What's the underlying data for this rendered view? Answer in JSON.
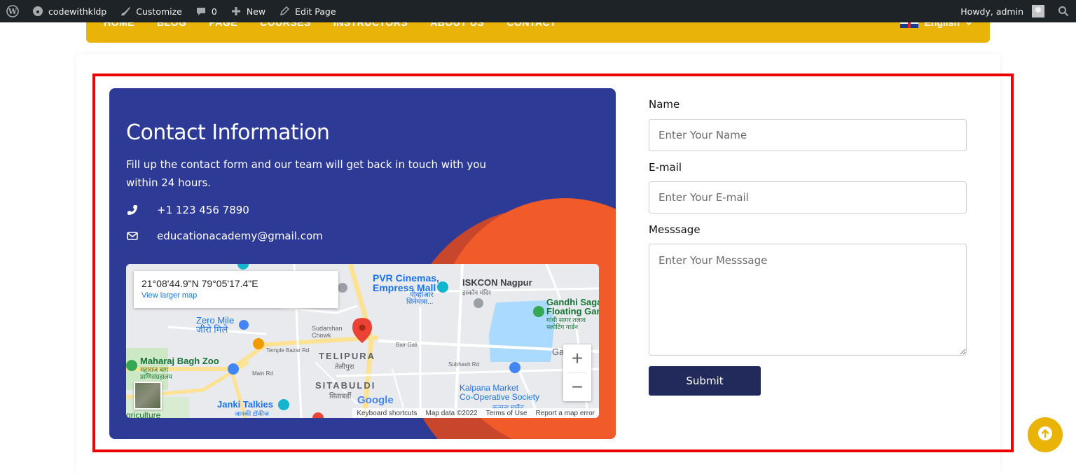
{
  "adminbar": {
    "site_name": "codewithkldp",
    "customize": "Customize",
    "comments_count": "0",
    "new": "New",
    "edit_page": "Edit Page",
    "howdy": "Howdy, admin"
  },
  "nav": {
    "items": [
      "HOME",
      "BLOG",
      "PAGE",
      "COURSES",
      "INSTRUCTORS",
      "ABOUT US",
      "CONTACT"
    ],
    "language": "English"
  },
  "contact_info": {
    "title": "Contact Information",
    "description": "Fill up the contact form and our team will get back in touch with you within 24 hours.",
    "phone": "+1 123 456 7890",
    "email": "educationacademy@gmail.com"
  },
  "map": {
    "coordinates": "21°08'44.9\"N 79°05'17.4\"E",
    "view_larger": "View larger map",
    "labels": {
      "pvr": "PVR Cinemas,",
      "pvr2": "Empress Mall",
      "pvr_hi": "पीव्हीआर",
      "pvr_hi2": "सिनेमास...",
      "iskcon": "ISKCON Nagpur",
      "iskcon_hi": "इस्कॉन मंदिर",
      "gandhi": "Gandhi Saga",
      "gandhi2": "Floating Gar",
      "gandhi_hi": "गांधी सागर तलाव",
      "gandhi_hi2": "फ्लोटिंग गार्डन",
      "zero_mile": "Zero Mile",
      "zero_mile_hi": "जीरो मिले",
      "sudarshan": "Sudarshan",
      "chowk": "Chowk",
      "temple_bazar": "Temple Bazar Rd",
      "bair_gali": "Bair Gali",
      "telipura": "TELIPURA",
      "telipura_hi": "तेलीपुरा",
      "maharaj": "Maharaj Bagh Zoo",
      "maharaj_hi": "महाराज बाग",
      "maharaj_hi2": "प्राणिसंग्रहालय",
      "main_rd": "Main Rd",
      "subhash": "Subhash Rd",
      "sitabuldi": "SITABULDI",
      "sitabuldi_hi": "सिताबर्डी",
      "kalpana": "Kalpana Market",
      "kalpana2": "Co-Operative Society",
      "kalpana_hi": "कल्पना मार्केट",
      "janki": "Janki Talkies",
      "janki_hi": "जानकी टॉकीज",
      "agriculture": "griculture",
      "ga": "Ga",
      "google": "Google"
    },
    "zoom_in": "+",
    "zoom_out": "−",
    "attribution": {
      "shortcuts": "Keyboard shortcuts",
      "data": "Map data ©2022",
      "terms": "Terms of Use",
      "report": "Report a map error"
    }
  },
  "form": {
    "name_label": "Name",
    "name_placeholder": "Enter Your Name",
    "email_label": "E-mail",
    "email_placeholder": "Enter Your E-mail",
    "message_label": "Messsage",
    "message_placeholder": "Enter Your Messsage",
    "submit": "Submit"
  },
  "colors": {
    "adminbar": "#1d2327",
    "nav": "#eab308",
    "panel": "#2d3a96",
    "accent_orange": "#f15a29",
    "submit": "#212a5a",
    "outline": "#ef0000"
  },
  "icons": [
    "wordpress-icon",
    "dashboard-icon",
    "brush-icon",
    "comment-icon",
    "plus-icon",
    "pencil-icon",
    "search-icon",
    "phone-icon",
    "envelope-icon",
    "arrow-up-icon",
    "map-pin-icon"
  ]
}
